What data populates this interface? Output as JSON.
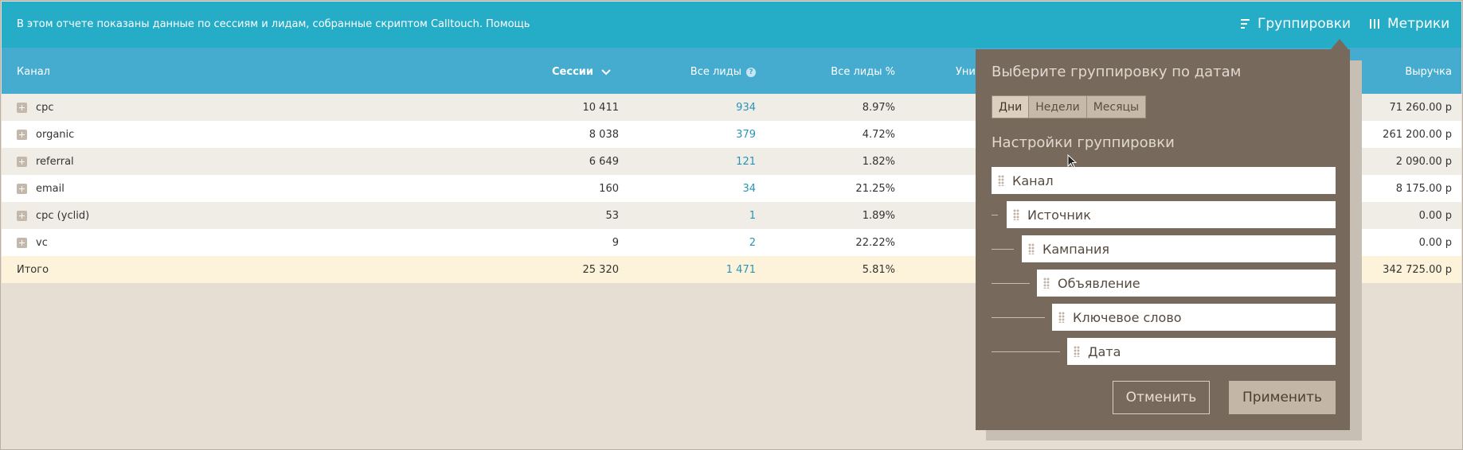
{
  "topbar": {
    "info_text": "В этом отчете показаны данные по сессиям и лидам, собранные скриптом Calltouch.",
    "help_link": "Помощь",
    "grouping_label": "Группировки",
    "metrics_label": "Метрики"
  },
  "table": {
    "headers": {
      "channel": "Канал",
      "sessions": "Сессии",
      "leads": "Все лиды",
      "leads_help": "?",
      "leads_pct": "Все лиды %",
      "unique": "Уни",
      "revenue": "Выручка"
    },
    "rows": [
      {
        "name": "cpc",
        "sessions": "10 411",
        "leads": "934",
        "pct": "8.97%",
        "revenue": "71 260.00 р"
      },
      {
        "name": "organic",
        "sessions": "8 038",
        "leads": "379",
        "pct": "4.72%",
        "revenue": "261 200.00 р"
      },
      {
        "name": "referral",
        "sessions": "6 649",
        "leads": "121",
        "pct": "1.82%",
        "revenue": "2 090.00 р"
      },
      {
        "name": "email",
        "sessions": "160",
        "leads": "34",
        "pct": "21.25%",
        "revenue": "8 175.00 р"
      },
      {
        "name": "cpc (yclid)",
        "sessions": "53",
        "leads": "1",
        "pct": "1.89%",
        "revenue": "0.00 р"
      },
      {
        "name": "vc",
        "sessions": "9",
        "leads": "2",
        "pct": "22.22%",
        "revenue": "0.00 р"
      }
    ],
    "total": {
      "name": "Итого",
      "sessions": "25 320",
      "leads": "1 471",
      "pct": "5.81%",
      "revenue": "342 725.00 р"
    }
  },
  "popup": {
    "date_title": "Выберите группировку по датам",
    "date_options": [
      "Дни",
      "Недели",
      "Месяцы"
    ],
    "date_selected": "Дни",
    "settings_title": "Настройки группировки",
    "items": [
      "Канал",
      "Источник",
      "Кампания",
      "Объявление",
      "Ключевое слово",
      "Дата"
    ],
    "cancel_label": "Отменить",
    "apply_label": "Применить"
  },
  "icons": {
    "grouping": "grouping-icon",
    "metrics": "columns-icon",
    "sort": "chevron-down-icon",
    "help": "question-icon",
    "expand": "plus-icon",
    "drag": "drag-handle-icon",
    "cursor": "mouse-cursor-icon"
  },
  "colors": {
    "topbar": "#25adc8",
    "header": "#45abcf",
    "popup": "#77695b",
    "link": "#2795b9",
    "total_row": "#fdf3da"
  }
}
